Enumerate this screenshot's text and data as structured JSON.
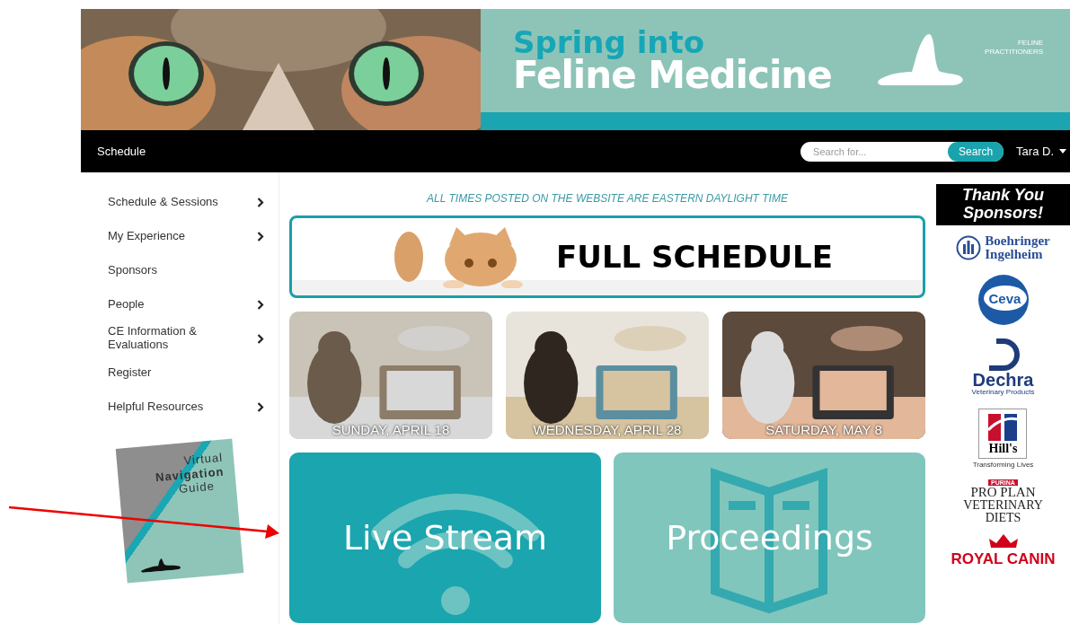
{
  "banner": {
    "title_line_1": "Spring into",
    "title_line_2": "Feline Medicine",
    "logo_text": "FELINE PRACTITIONERS"
  },
  "navbar": {
    "link": "Schedule",
    "search": {
      "placeholder": "Search for...",
      "button": "Search"
    },
    "user": "Tara D."
  },
  "sidebar": {
    "items": [
      {
        "label": "Schedule & Sessions",
        "has_submenu": true
      },
      {
        "label": "My Experience",
        "has_submenu": true
      },
      {
        "label": "Sponsors",
        "has_submenu": false
      },
      {
        "label": "People",
        "has_submenu": true
      },
      {
        "label": "CE Information & Evaluations",
        "has_submenu": true
      },
      {
        "label": "Register",
        "has_submenu": false
      },
      {
        "label": "Helpful Resources",
        "has_submenu": true
      }
    ],
    "guide": {
      "line_1": "Virtual",
      "line_2": "Navigation",
      "line_3": "Guide"
    }
  },
  "main": {
    "notice": "ALL TIMES POSTED ON THE WEBSITE ARE EASTERN DAYLIGHT TIME",
    "full_schedule": "FULL SCHEDULE",
    "days": [
      {
        "caption": "SUNDAY, APRIL 18"
      },
      {
        "caption": "WEDNESDAY, APRIL 28"
      },
      {
        "caption": "SATURDAY, MAY 8"
      }
    ],
    "tiles": [
      {
        "kind": "stream",
        "label": "Live Stream"
      },
      {
        "kind": "book",
        "label": "Proceedings"
      }
    ]
  },
  "sponsors": {
    "heading": "Thank You Sponsors!",
    "logos": [
      {
        "kind": "boehringer",
        "lines": [
          "Boehringer",
          "Ingelheim"
        ]
      },
      {
        "kind": "ceva",
        "lines": [
          "Ceva"
        ]
      },
      {
        "kind": "dechra",
        "lines": [
          "Dechra",
          "Veterinary Products"
        ]
      },
      {
        "kind": "hills",
        "lines": [
          "Hill's",
          "Transforming Lives"
        ]
      },
      {
        "kind": "purina",
        "lines": [
          "PURINA",
          "PRO PLAN",
          "VETERINARY",
          "DIETS"
        ]
      },
      {
        "kind": "royal",
        "lines": [
          "ROYAL CANIN"
        ]
      }
    ]
  }
}
